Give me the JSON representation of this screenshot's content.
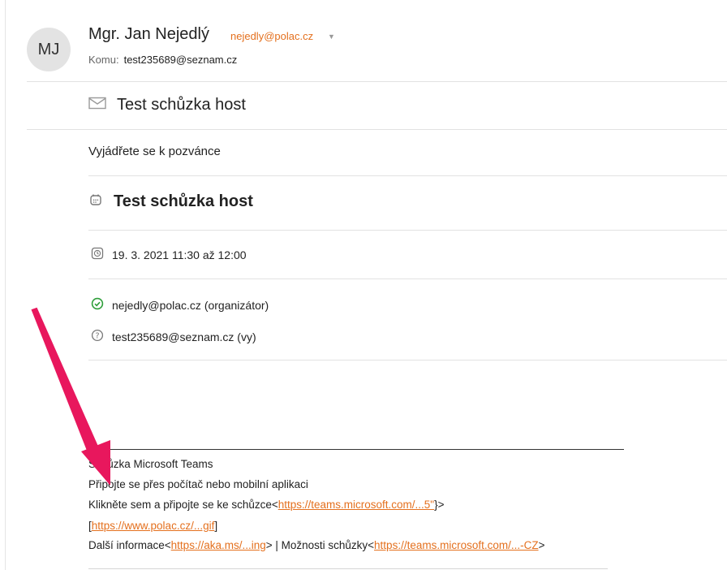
{
  "sender": {
    "avatar_initials": "MJ",
    "name": "Mgr. Jan Nejedlý",
    "email": "nejedly@polac.cz",
    "to_label": "Komu:",
    "to_value": "test235689@seznam.cz"
  },
  "subject": "Test schůzka host",
  "invite_prompt": "Vyjádřete se k pozvánce",
  "event": {
    "title": "Test schůzka host",
    "datetime": "19. 3. 2021 11:30 až 12:00",
    "attendees": [
      {
        "text": "nejedly@polac.cz (organizátor)",
        "status_icon": "check-circle-icon"
      },
      {
        "text": "test235689@seznam.cz (vy)",
        "status_icon": "question-circle-icon"
      }
    ]
  },
  "body": {
    "teams_title": "Schůzka Microsoft Teams",
    "connect_line": "Připojte se přes počítač nebo mobilní aplikaci",
    "click_text": "Klikněte sem a připojte se ke schůzce<",
    "click_link": "https://teams.microsoft.com/...5\"",
    "click_end": "}>",
    "bracket_open": "[",
    "image_link": "https://www.polac.cz/...gif",
    "bracket_close": "]",
    "more_info_text": "Další informace<",
    "more_info_link": "https://aka.ms/...ing",
    "options_text": "> | Možnosti schůzky<",
    "options_link": "https://teams.microsoft.com/...-CZ",
    "options_end": ">"
  },
  "colors": {
    "accent_link": "#e4701e",
    "annotation_arrow": "#e8175d",
    "accepted_green": "#2e9e3a"
  }
}
